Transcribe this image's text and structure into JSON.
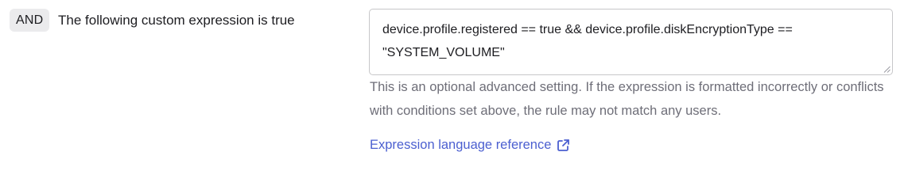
{
  "condition": {
    "operator_badge": "AND",
    "label": "The following custom expression is true"
  },
  "expression_field": {
    "value": "device.profile.registered == true && device.profile.diskEncryptionType == \"SYSTEM_VOLUME\""
  },
  "help_text": "This is an optional advanced setting. If the expression is formatted incorrectly or conflicts with conditions set above, the rule may not match any users.",
  "reference_link": {
    "label": "Expression language reference",
    "icon": "external-link-icon"
  },
  "colors": {
    "badge_background": "#ebebed",
    "text_primary": "#1d1d21",
    "text_secondary": "#6e6e78",
    "link": "#4b5fd0",
    "field_border": "#c7c7c9"
  }
}
